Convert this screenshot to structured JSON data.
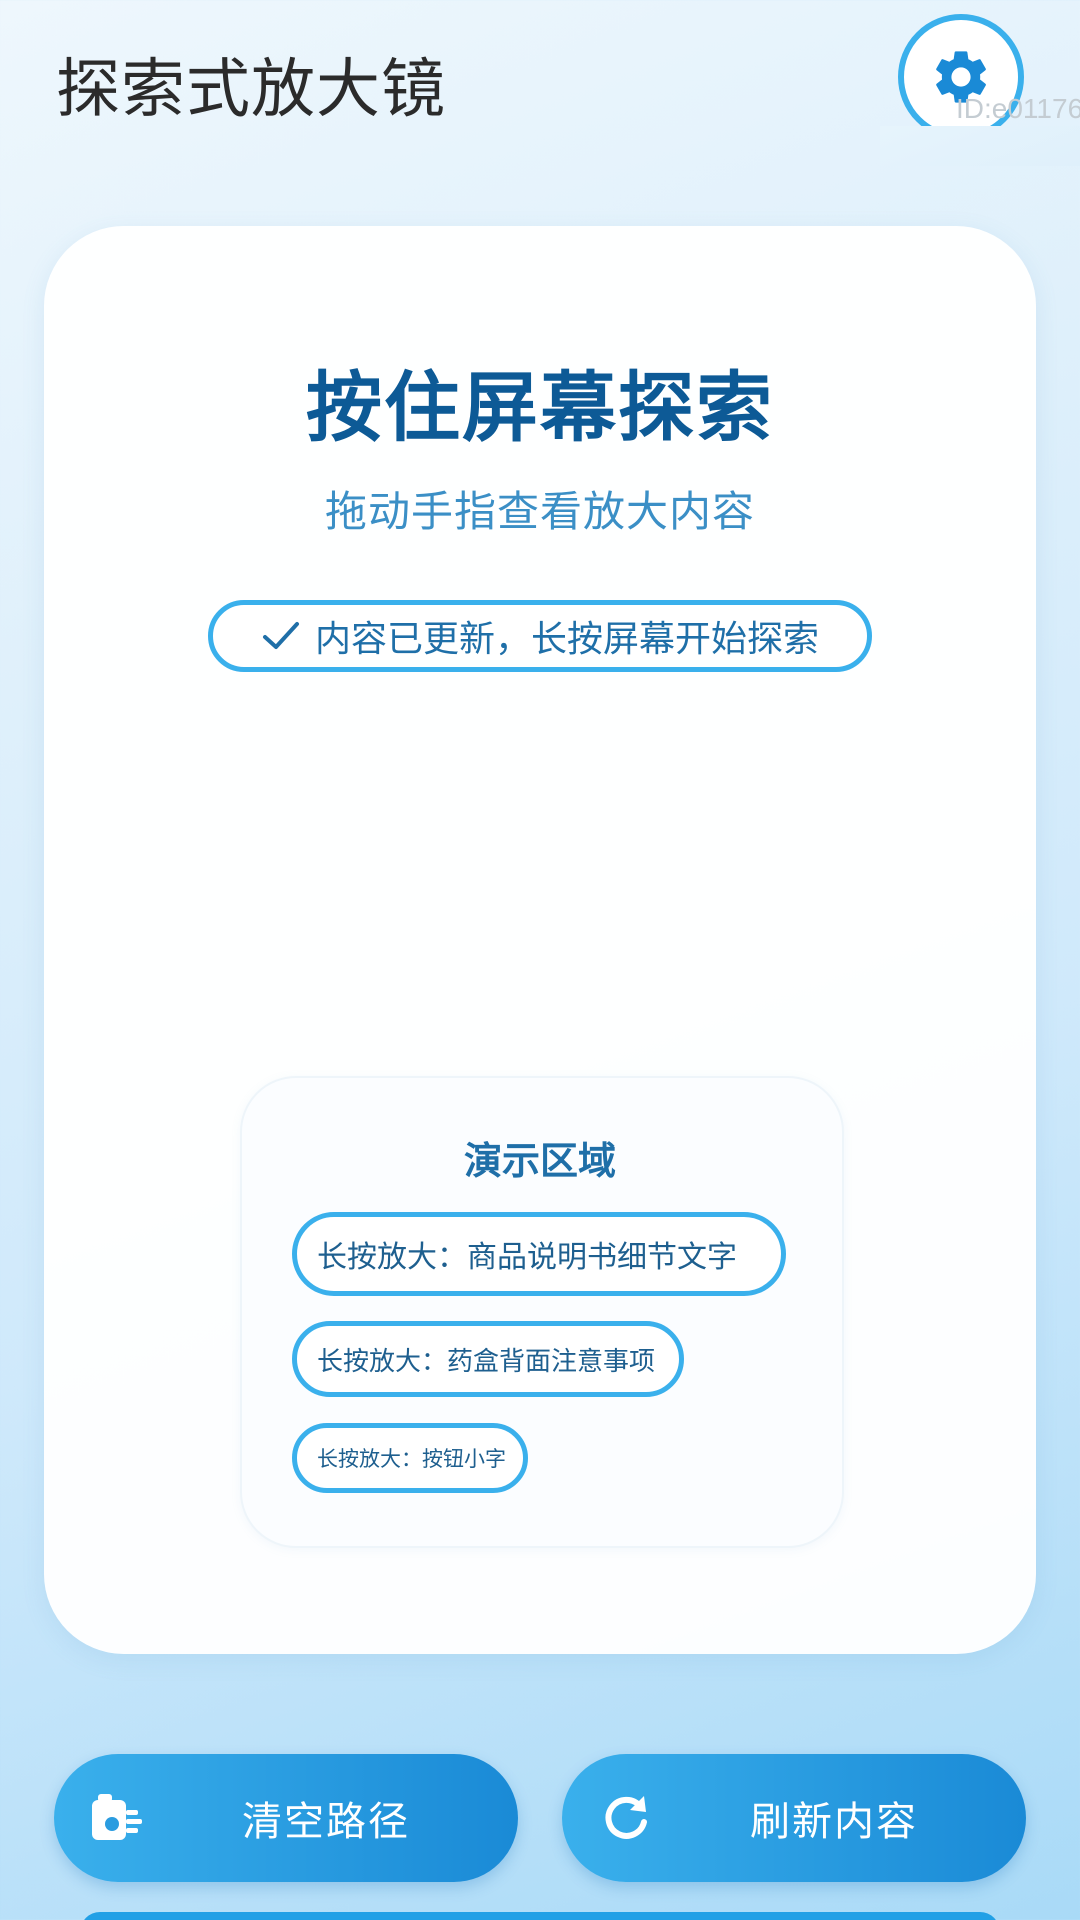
{
  "app": {
    "title": "探索式放大镜",
    "id_tag": "ID:e01176"
  },
  "header": {
    "settings_icon": "gear-icon"
  },
  "main": {
    "headline": "按住屏幕探索",
    "subline": "拖动手指查看放大内容",
    "status": "内容已更新，长按屏幕开始探索",
    "status_icon": "check-icon"
  },
  "demo": {
    "title": "演示区域",
    "items": [
      {
        "label": "长按放大：商品说明书细节文字"
      },
      {
        "label": "长按放大：药盒背面注意事项"
      },
      {
        "label": "长按放大：按钮小字"
      }
    ]
  },
  "actions": {
    "clear": {
      "label": "清空路径",
      "icon": "erase-path-icon"
    },
    "refresh": {
      "label": "刷新内容",
      "icon": "refresh-icon"
    }
  },
  "colors": {
    "accent": "#3ab0ec",
    "accent_dark": "#1a8ad6",
    "headline": "#0d5a96",
    "text_blue": "#1f6fa8"
  }
}
